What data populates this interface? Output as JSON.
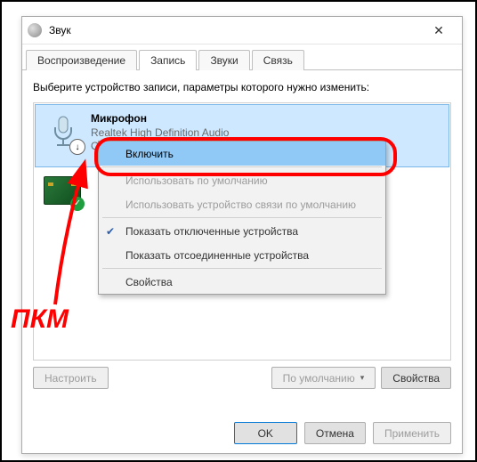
{
  "window": {
    "title": "Звук"
  },
  "tabs": {
    "playback": "Воспроизведение",
    "recording": "Запись",
    "sounds": "Звуки",
    "comm": "Связь"
  },
  "instruction": "Выберите устройство записи, параметры которого нужно изменить:",
  "devices": {
    "mic": {
      "name": "Микрофон",
      "desc": "Realtek High Definition Audio",
      "state": "Отключено"
    }
  },
  "context_menu": {
    "enable": "Включить",
    "set_default": "Использовать по умолчанию",
    "set_default_comm": "Использовать устройство связи по умолчанию",
    "show_disabled": "Показать отключенные устройства",
    "show_disconnected": "Показать отсоединенные устройства",
    "properties": "Свойства"
  },
  "buttons": {
    "configure": "Настроить",
    "set_default": "По умолчанию",
    "properties": "Свойства",
    "ok": "OK",
    "cancel": "Отмена",
    "apply": "Применить"
  },
  "annotation": {
    "pkm": "ПКМ"
  }
}
